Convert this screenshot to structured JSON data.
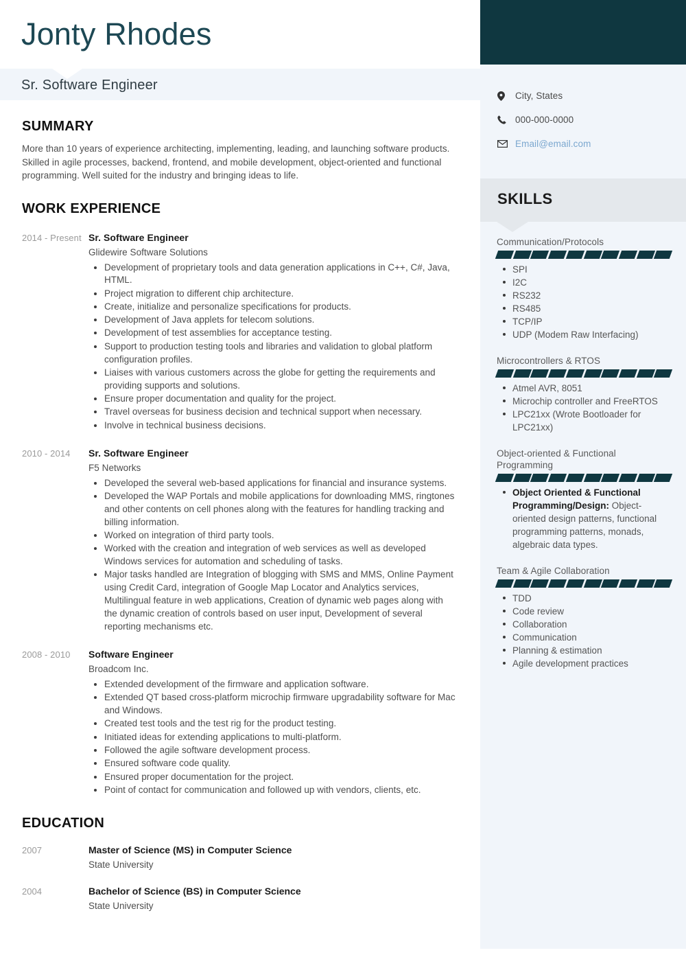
{
  "header": {
    "name": "Jonty Rhodes",
    "job_title": "Sr. Software Engineer"
  },
  "contact": {
    "location": "City, States",
    "location_icon": "map-pin-icon",
    "phone": "000-000-0000",
    "phone_icon": "phone-icon",
    "email": "Email@email.com",
    "email_icon": "envelope-icon",
    "email_color": "#7ba7cf"
  },
  "colors": {
    "dark_teal": "#0f3740",
    "name_teal": "#1d4854",
    "band_light": "#f1f5fa",
    "band_gray": "#e4e8ec"
  },
  "summary": {
    "heading": "SUMMARY",
    "text": "More than 10 years of experience architecting, implementing, leading, and launching software products. Skilled in agile processes, backend, frontend, and mobile development, object-oriented and functional programming. Well suited for the industry and bringing ideas to life."
  },
  "work": {
    "heading": "WORK EXPERIENCE",
    "entries": [
      {
        "date": "2014 - Present",
        "role": "Sr. Software Engineer",
        "org": "Glidewire Software Solutions",
        "bullets": [
          "Development of proprietary tools and data generation applications in C++, C#, Java, HTML.",
          "Project migration to different chip architecture.",
          "Create, initialize and personalize specifications for products.",
          "Development of Java applets for telecom solutions.",
          "Development of test assemblies for acceptance testing.",
          "Support to production testing tools and libraries and validation to global platform configuration profiles.",
          "Liaises with various customers across the globe for getting the requirements and providing supports and solutions.",
          "Ensure proper documentation and quality for the project.",
          "Travel overseas for business decision and technical support when necessary.",
          "Involve in technical business decisions."
        ]
      },
      {
        "date": "2010 - 2014",
        "role": "Sr. Software Engineer",
        "org": "F5 Networks",
        "bullets": [
          "Developed the several web-based applications for financial and insurance systems.",
          "Developed the WAP Portals and mobile applications for downloading MMS, ringtones and other contents on cell phones along with the features for handling tracking and billing information.",
          "Worked on integration of third party tools.",
          "Worked with the creation and integration of web services as well as developed Windows services for automation and scheduling of tasks.",
          "Major tasks handled are Integration of blogging with SMS and MMS, Online Payment using Credit Card, integration of Google Map Locator and Analytics services, Multilingual feature in web applications, Creation of dynamic web pages along with the dynamic creation of controls based on user input, Development of several reporting mechanisms etc."
        ]
      },
      {
        "date": "2008 - 2010",
        "role": "Software Engineer",
        "org": "Broadcom Inc.",
        "bullets": [
          "Extended development of the firmware and application software.",
          "Extended QT based cross-platform microchip firmware upgradability software for Mac and Windows.",
          "Created test tools and the test rig for the product testing.",
          "Initiated ideas for extending applications to multi-platform.",
          "Followed the agile software development process.",
          "Ensured software code quality.",
          "Ensured proper documentation for the project.",
          "Point of contact for communication and followed up with vendors, clients, etc."
        ]
      }
    ]
  },
  "education": {
    "heading": "EDUCATION",
    "entries": [
      {
        "date": "2007",
        "degree": "Master of Science (MS) in Computer Science",
        "school": "State University"
      },
      {
        "date": "2004",
        "degree": "Bachelor of Science (BS) in Computer Science",
        "school": "State University"
      }
    ]
  },
  "skills": {
    "heading": "SKILLS",
    "bar_segments": 10,
    "groups": [
      {
        "name": "Communication/Protocols",
        "items": [
          "SPI",
          "I2C",
          "RS232",
          "RS485",
          "TCP/IP",
          "UDP (Modem Raw Interfacing)"
        ]
      },
      {
        "name": "Microcontrollers & RTOS",
        "items": [
          "Atmel AVR, 8051",
          "Microchip controller and FreeRTOS",
          "LPC21xx (Wrote Bootloader for LPC21xx)"
        ]
      },
      {
        "name": "Object-oriented & Functional Programming",
        "items": [],
        "rich_items": [
          {
            "bold": "Object Oriented & Functional Programming/Design:",
            "rest": " Object-oriented design patterns, functional programming patterns, monads, algebraic data types."
          }
        ]
      },
      {
        "name": "Team & Agile Collaboration",
        "items": [
          "TDD",
          "Code review",
          "Collaboration",
          "Communication",
          "Planning & estimation",
          "Agile development practices"
        ]
      }
    ]
  }
}
